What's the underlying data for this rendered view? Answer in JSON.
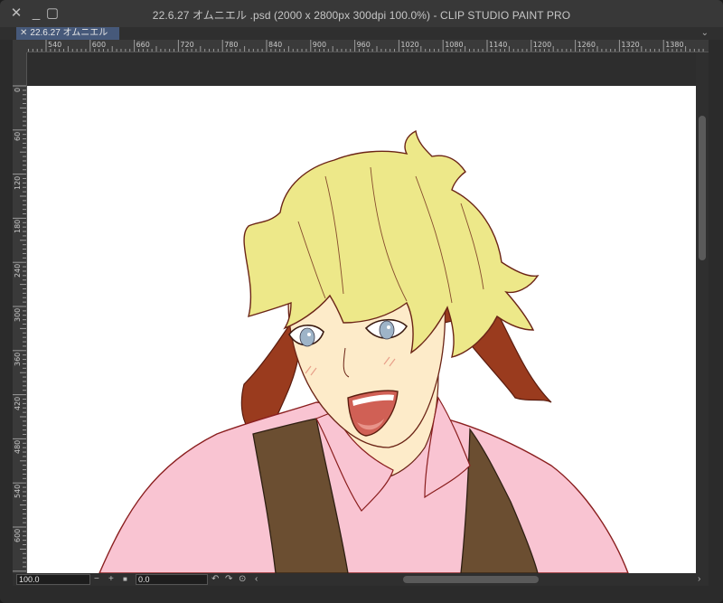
{
  "window": {
    "title": "22.6.27 オムニエル .psd (2000 x 2800px 300dpi 100.0%)  - CLIP STUDIO PAINT PRO",
    "controls": {
      "close": "✕",
      "minimize": "_",
      "maximize": "▢"
    }
  },
  "tab": {
    "label": "22.6.27 オムニエル .psd",
    "close": "✕",
    "menu": "⌄"
  },
  "ruler_top": {
    "labels": [
      "540",
      "600",
      "660",
      "720",
      "780",
      "840",
      "900",
      "960",
      "1020",
      "1080",
      "1140",
      "1200",
      "1260",
      "1320",
      "1380"
    ]
  },
  "ruler_left": {
    "labels": [
      "0",
      "60",
      "120",
      "180",
      "240",
      "300",
      "360",
      "420",
      "480",
      "540",
      "600"
    ]
  },
  "statusbar": {
    "zoom_value": "100.0",
    "rotation_value": "0.0",
    "zoom_out": "−",
    "zoom_in": "+",
    "fit": "■",
    "rotate_left": "↶",
    "rotate_right": "↷",
    "reset": "⊙",
    "scroll_left": "‹",
    "scroll_right": "›"
  },
  "colors": {
    "hair_blonde": "#ede889",
    "hair_auburn": "#9a3b1e",
    "skin": "#fdebc9",
    "shirt": "#f9c4d2",
    "vest": "#6b4e31",
    "eyes": "#9eb4c8",
    "mouth": "#d06055",
    "line": "#6b2416"
  }
}
